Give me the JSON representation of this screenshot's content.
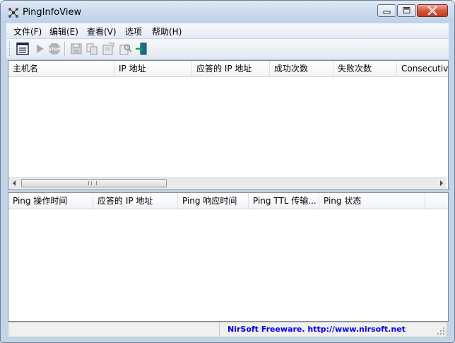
{
  "window": {
    "title": "PingInfoView"
  },
  "menu": [
    {
      "label": "文件(F)"
    },
    {
      "label": "编辑(E)"
    },
    {
      "label": "查看(V)"
    },
    {
      "label": "选项"
    },
    {
      "label": "帮助(H)"
    }
  ],
  "toolbar": [
    {
      "name": "options-icon"
    },
    {
      "name": "start-ping-icon"
    },
    {
      "name": "stop-ping-icon"
    },
    {
      "name": "save-icon"
    },
    {
      "name": "copy-icon"
    },
    {
      "name": "properties-icon"
    },
    {
      "name": "find-icon"
    },
    {
      "name": "exit-icon"
    }
  ],
  "top_table": {
    "columns": [
      "主机名",
      "IP 地址",
      "应答的 IP 地址",
      "成功次数",
      "失败次数",
      "Consecutive"
    ],
    "rows": []
  },
  "bottom_table": {
    "columns": [
      "Ping 操作时间",
      "应答的 IP 地址",
      "Ping 响应时间",
      "Ping TTL 传输...",
      "Ping 状态"
    ],
    "rows": []
  },
  "scrollbar": {
    "thumb_grip": "III"
  },
  "status": {
    "link": "NirSoft Freeware.  http://www.nirsoft.net"
  },
  "colors": {
    "link": "#0000ee",
    "close_button": "#c23a1f"
  }
}
